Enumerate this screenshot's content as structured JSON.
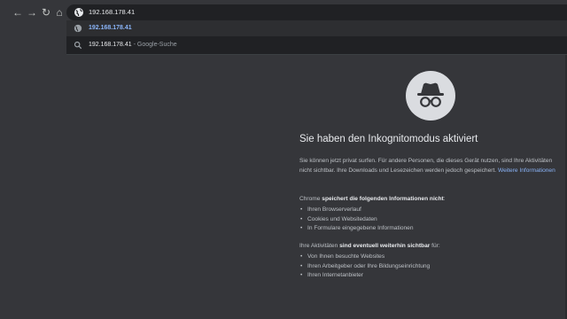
{
  "toolbar": {
    "back_icon": "←",
    "forward_icon": "→",
    "reload_icon": "↻",
    "home_icon": "⌂"
  },
  "omnibox": {
    "value": "192.168.178.41"
  },
  "suggestions": [
    {
      "text": "192.168.178.41",
      "icon": "globe-icon"
    },
    {
      "text": "192.168.178.41",
      "suffix": "- Google-Suche",
      "icon": "search-icon"
    }
  ],
  "incognito": {
    "title": "Sie haben den Inkognitomodus aktiviert",
    "intro": "Sie können jetzt privat surfen. Für andere Personen, die dieses Gerät nutzen, sind Ihre Aktivitäten nicht sichtbar. Ihre Downloads und Lesezeichen werden jedoch gespeichert.",
    "intro_link": "Weitere Informationen",
    "not_saved_prefix": "Chrome ",
    "not_saved_bold": "speichert die folgenden Informationen nicht",
    "not_saved_suffix": ":",
    "not_saved_items": [
      "Ihren Browserverlauf",
      "Cookies und Websitedaten",
      "In Formulare eingegebene Informationen"
    ],
    "visible_prefix": "Ihre Aktivitäten ",
    "visible_bold": "sind eventuell weiterhin sichtbar",
    "visible_suffix": " für:",
    "visible_items": [
      "Von Ihnen besuchte Websites",
      "Ihren Arbeitgeber oder Ihre Bildungseinrichtung",
      "Ihren Internetanbieter"
    ]
  },
  "colors": {
    "background": "#35363a",
    "omnibox": "#202124",
    "link": "#8ab4f8"
  }
}
